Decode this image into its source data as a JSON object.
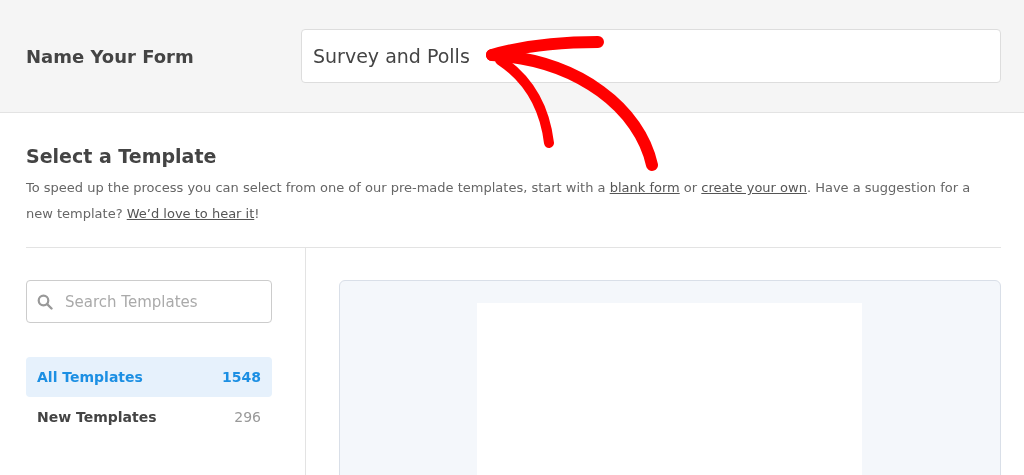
{
  "header": {
    "label": "Name Your Form",
    "form_name": "Survey and Polls"
  },
  "section": {
    "title": "Select a Template",
    "description": [
      {
        "kind": "text",
        "text": "To speed up the process you can select from one of our pre-made templates, start with a "
      },
      {
        "kind": "link",
        "text": "blank form"
      },
      {
        "kind": "text",
        "text": " or "
      },
      {
        "kind": "link",
        "text": "create your own"
      },
      {
        "kind": "text",
        "text": ". Have a suggestion for a new template? "
      },
      {
        "kind": "link",
        "text": "We’d love to hear it"
      },
      {
        "kind": "text",
        "text": "!"
      }
    ]
  },
  "search": {
    "placeholder": "Search Templates"
  },
  "categories": [
    {
      "label": "All Templates",
      "count": "1548",
      "selected": true
    },
    {
      "label": "New Templates",
      "count": "296",
      "selected": false
    }
  ]
}
